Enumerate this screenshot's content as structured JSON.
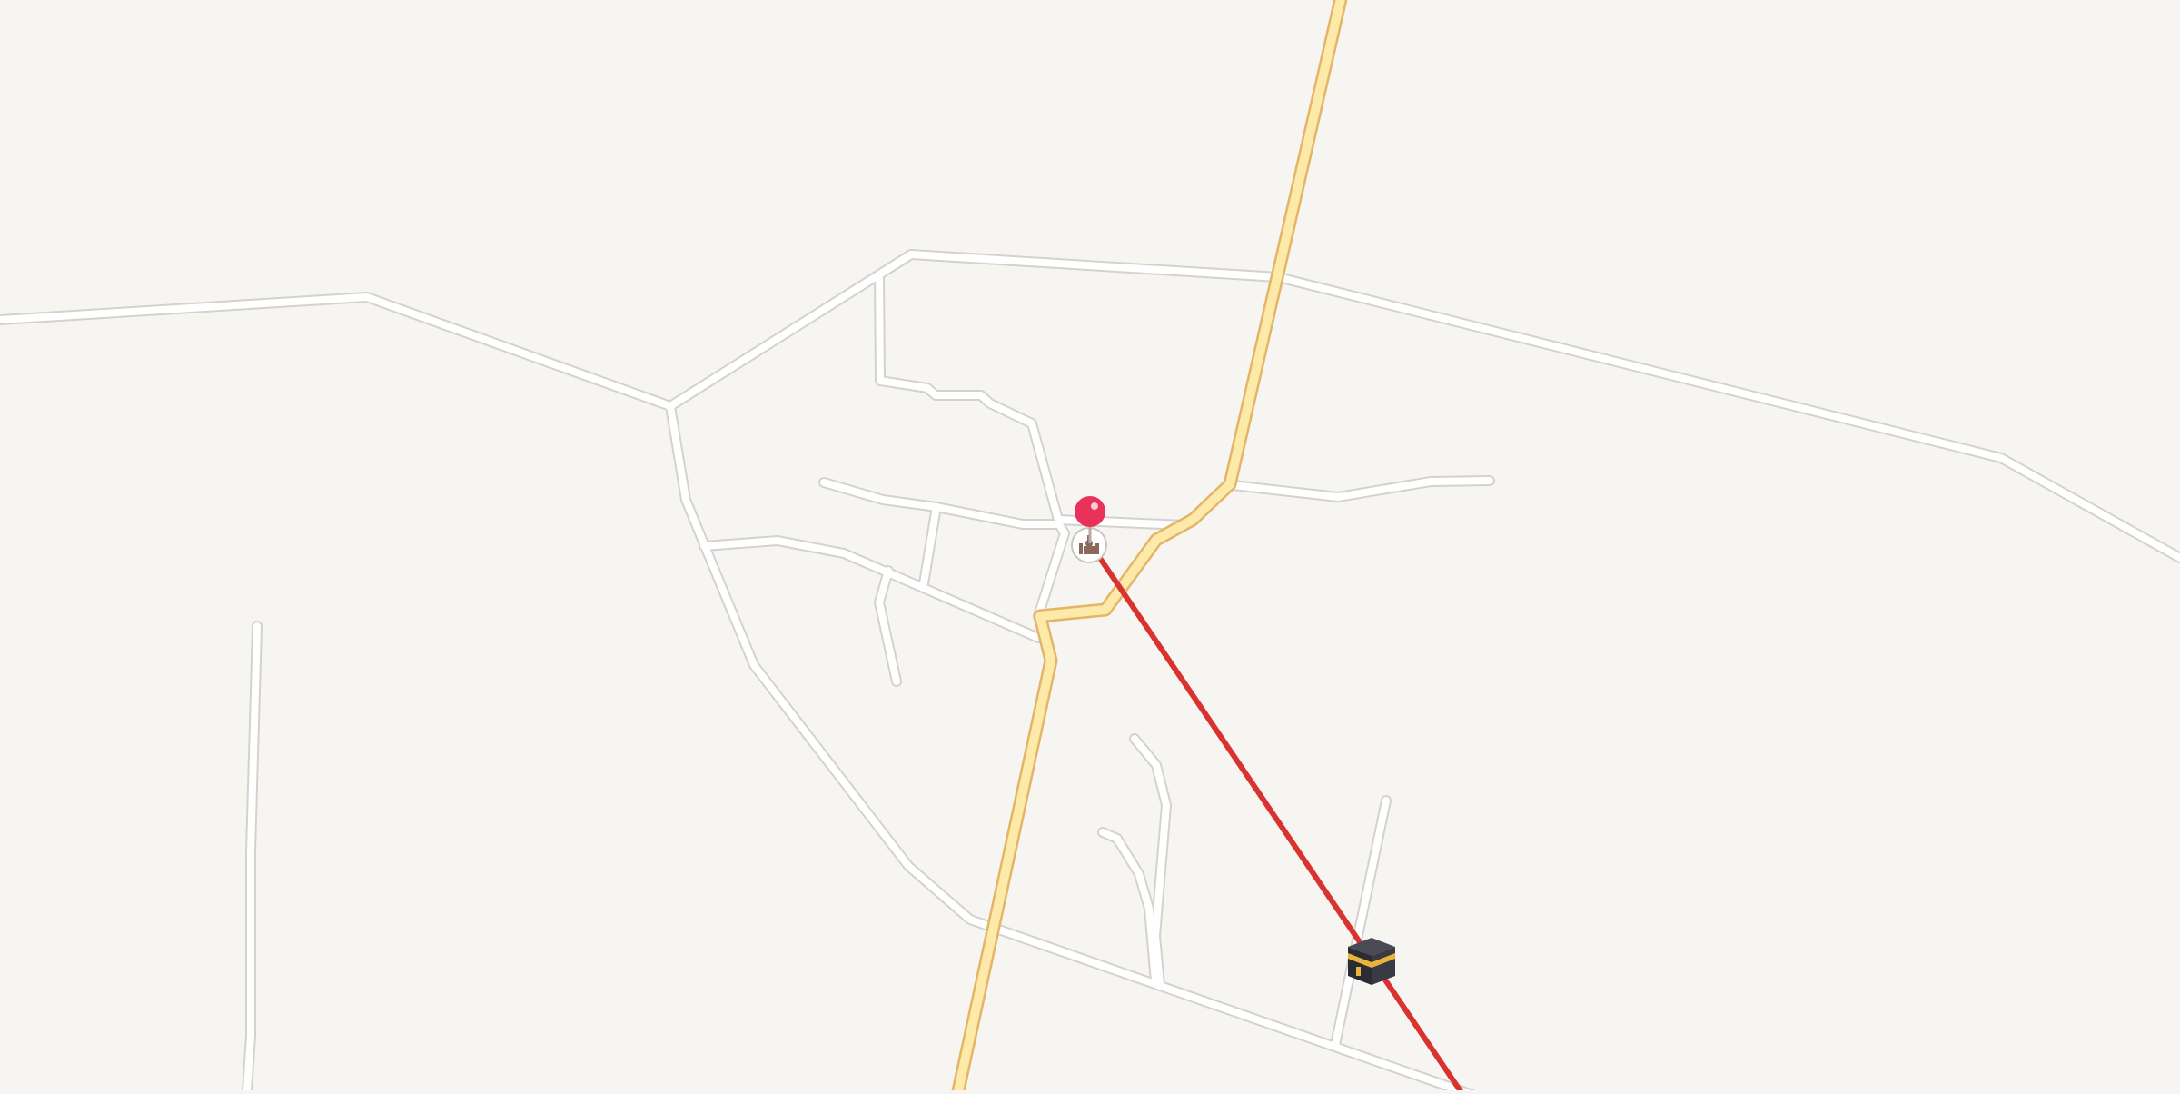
{
  "map": {
    "background_color": "#f7f5f2",
    "minor_road_color": "#ffffff",
    "minor_road_outline_color": "#d4d2cf",
    "main_road_color": "#fde9a8",
    "main_road_outline_color": "#e3b567",
    "direction_line_color": "#d93331"
  },
  "markers": {
    "location_pin": {
      "icon": "red-location-pin-icon",
      "color": "#e8325a"
    },
    "mosque_poi": {
      "icon": "mosque-icon",
      "color": "#8a6a5c"
    },
    "kaaba": {
      "icon": "kaaba-icon",
      "color": "#2b2b33",
      "accent_color": "#e9b43a"
    }
  }
}
